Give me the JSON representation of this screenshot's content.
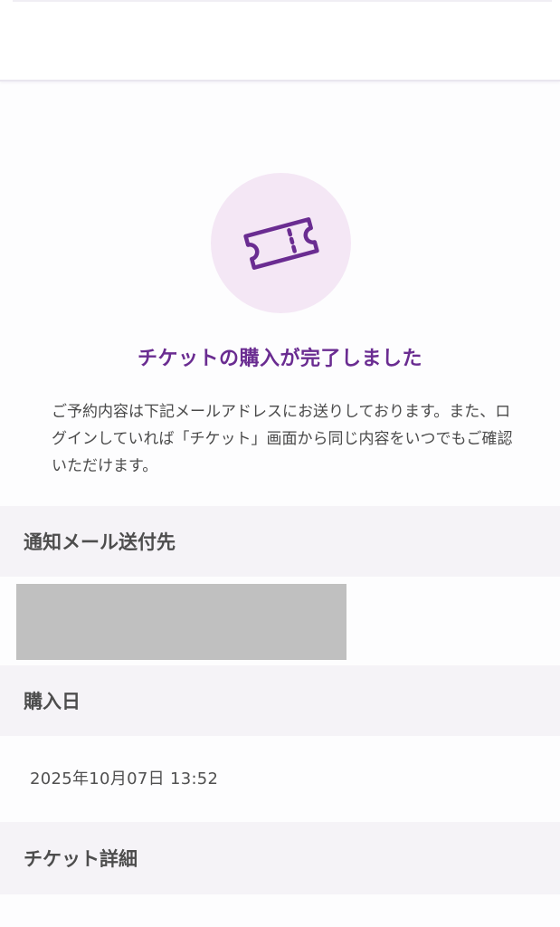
{
  "success": {
    "icon": "ticket-icon",
    "title": "チケットの購入が完了しました",
    "description": "ご予約内容は下記メールアドレスにお送りしております。また、ログインしていれば「チケット」画面から同じ内容をいつでもご確認いただけます。"
  },
  "sections": {
    "email": {
      "label": "通知メール送付先"
    },
    "purchase_date": {
      "label": "購入日",
      "value": "2025年10月07日 13:52"
    },
    "ticket_details": {
      "label": "チケット詳細"
    }
  },
  "colors": {
    "accent": "#6a2c91",
    "icon_circle": "#f4e7f5",
    "section_bg": "#f5f3f7",
    "redaction": "#c0c0c0"
  }
}
